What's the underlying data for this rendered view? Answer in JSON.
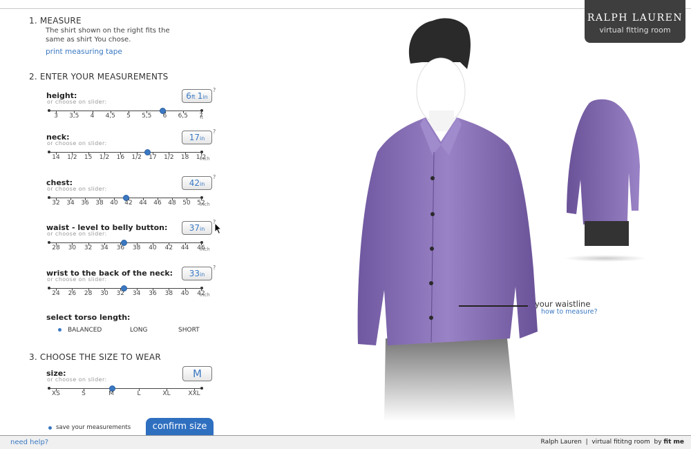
{
  "header": {
    "brand": "RALPH LAUREN",
    "subtitle": "virtual fitting room"
  },
  "step1": {
    "title": "1.  MEASURE",
    "text": "The shirt shown on the right fits the same as shirt You chose.",
    "print_link": "print measuring tape"
  },
  "step2": {
    "title": "2.  ENTER YOUR MEASUREMENTS",
    "hint": "or choose on slider:",
    "measurements": [
      {
        "label": "height:",
        "value": "6",
        "unit": "ft",
        "value2": "1",
        "unit2": "in",
        "tick_labels": [
          "3",
          "3,5",
          "4",
          "4,5",
          "5",
          "5,5",
          "6",
          "6,5",
          "7"
        ],
        "axis_unit": "ft",
        "slider_fraction": 0.74
      },
      {
        "label": "neck:",
        "value": "17",
        "unit": "in",
        "tick_labels": [
          "14",
          "1/2",
          "15",
          "1/2",
          "16",
          "1/2",
          "17",
          "1/2",
          "18",
          "1/2"
        ],
        "axis_unit": "inch",
        "slider_fraction": 0.64
      },
      {
        "label": "chest:",
        "value": "42",
        "unit": "in",
        "tick_labels": [
          "32",
          "34",
          "36",
          "38",
          "40",
          "42",
          "44",
          "46",
          "48",
          "50",
          "52"
        ],
        "axis_unit": "inch",
        "slider_fraction": 0.5
      },
      {
        "label": "waist - level to belly button:",
        "value": "37",
        "unit": "in",
        "tick_labels": [
          "28",
          "30",
          "32",
          "34",
          "36",
          "38",
          "40",
          "42",
          "44",
          "46"
        ],
        "axis_unit": "inch",
        "slider_fraction": 0.49
      },
      {
        "label": "wrist to the back of the neck:",
        "value": "33",
        "unit": "in",
        "tick_labels": [
          "24",
          "26",
          "28",
          "30",
          "32",
          "34",
          "36",
          "38",
          "40",
          "42"
        ],
        "axis_unit": "inch",
        "slider_fraction": 0.49
      }
    ],
    "help_mark": "?",
    "torso": {
      "title": "select torso length:",
      "options": [
        "BALANCED",
        "LONG",
        "SHORT"
      ],
      "selected": "BALANCED"
    }
  },
  "step3": {
    "title": "3.  CHOOSE THE SIZE TO WEAR",
    "size_label": "size:",
    "hint": "or choose on slider:",
    "value": "M",
    "options": [
      "XS",
      "S",
      "M",
      "L",
      "XL",
      "XXL"
    ],
    "slider_fraction": 0.41,
    "save_label": "save your measurements",
    "confirm_label": "confirm size"
  },
  "figure": {
    "waist_label": "your waistline",
    "waist_help": "how to measure?"
  },
  "footer": {
    "help": "need help?",
    "credits_brand": "Ralph Lauren",
    "credits_mid": "  |  virtual fititng room  by ",
    "credits_end": "fit me"
  },
  "colors": {
    "accent": "#3a78c2",
    "shirt": "#8a70b8",
    "logo_bg": "#3e3e3e"
  }
}
